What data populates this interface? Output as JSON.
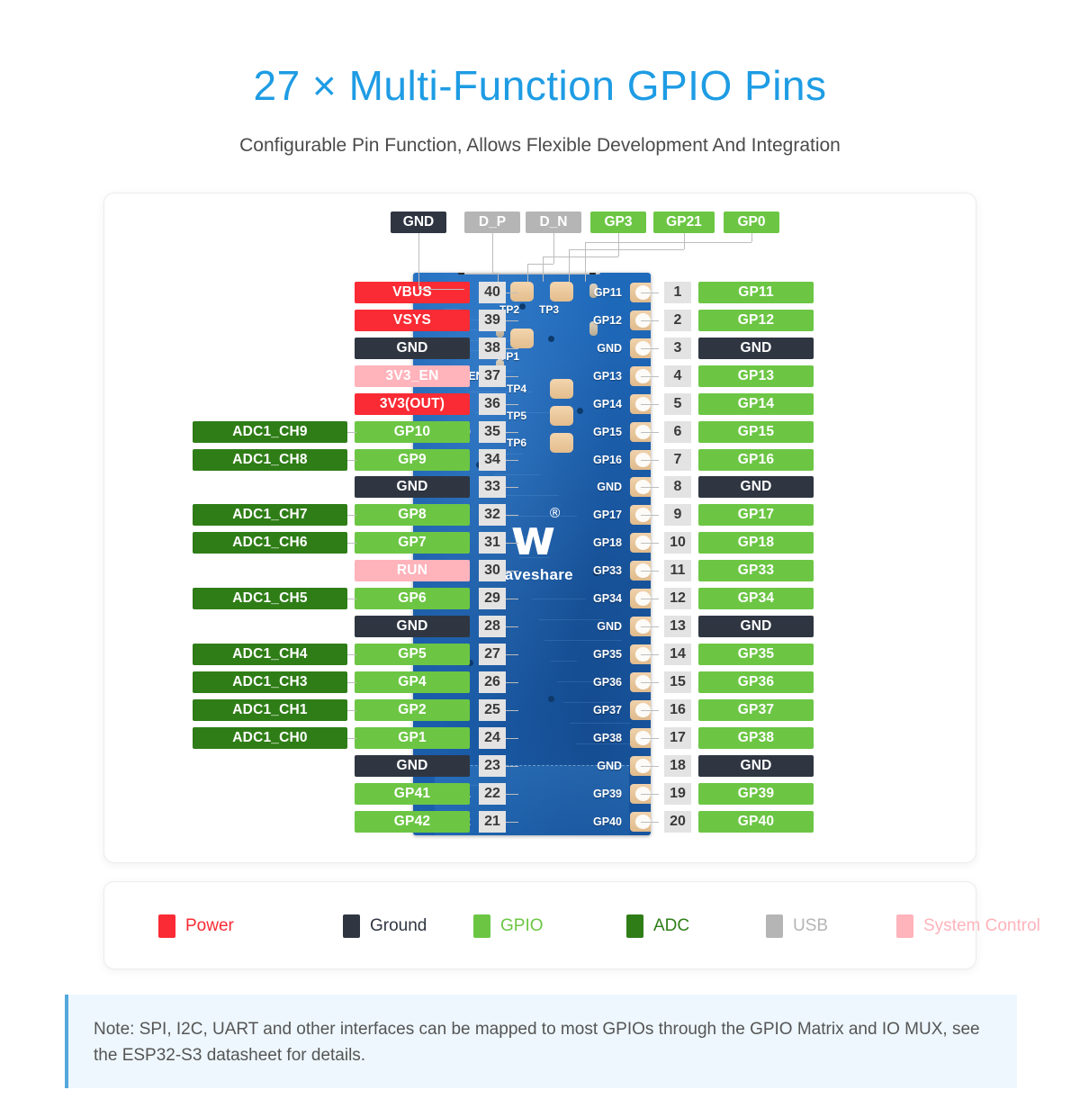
{
  "header": {
    "title": "27 × Multi-Function GPIO Pins",
    "subtitle": "Configurable Pin Function, Allows Flexible Development And Integration"
  },
  "colors": {
    "power": "#fa2b34",
    "ground": "#2f3642",
    "gpio": "#6cc644",
    "adc": "#2f7d17",
    "usb": "#b5b5b5",
    "system_control": "#ffb3bb",
    "accent": "#1e9ce4",
    "board": "#1c60ad"
  },
  "top_labels": [
    {
      "text": "GND",
      "type": "ground"
    },
    {
      "text": "D_P",
      "type": "usb"
    },
    {
      "text": "D_N",
      "type": "usb"
    },
    {
      "text": "GP3",
      "type": "gpio"
    },
    {
      "text": "GP21",
      "type": "gpio"
    },
    {
      "text": "GP0",
      "type": "gpio"
    }
  ],
  "left_pins": [
    {
      "num": "40",
      "name": "VBUS",
      "type": "power",
      "func": "",
      "silk": "Vbus"
    },
    {
      "num": "39",
      "name": "VSYS",
      "type": "power",
      "func": "",
      "silk": "Vsys"
    },
    {
      "num": "38",
      "name": "GND",
      "type": "ground",
      "func": "",
      "silk": "GND"
    },
    {
      "num": "37",
      "name": "3V3_EN",
      "type": "sys",
      "func": "",
      "silk": "3V3_EN"
    },
    {
      "num": "36",
      "name": "3V3(OUT)",
      "type": "power",
      "func": "",
      "silk": "3V3"
    },
    {
      "num": "35",
      "name": "GP10",
      "type": "gpio",
      "func": "ADC1_CH9",
      "silk": "GP10"
    },
    {
      "num": "34",
      "name": "GP9",
      "type": "gpio",
      "func": "ADC1_CH8",
      "silk": "GP9"
    },
    {
      "num": "33",
      "name": "GND",
      "type": "ground",
      "func": "",
      "silk": "GND"
    },
    {
      "num": "32",
      "name": "GP8",
      "type": "gpio",
      "func": "ADC1_CH7",
      "silk": "GP8"
    },
    {
      "num": "31",
      "name": "GP7",
      "type": "gpio",
      "func": "ADC1_CH6",
      "silk": "GP7"
    },
    {
      "num": "30",
      "name": "RUN",
      "type": "sys",
      "func": "",
      "silk": "RUN"
    },
    {
      "num": "29",
      "name": "GP6",
      "type": "gpio",
      "func": "ADC1_CH5",
      "silk": "GP6"
    },
    {
      "num": "28",
      "name": "GND",
      "type": "ground",
      "func": "",
      "silk": "GND"
    },
    {
      "num": "27",
      "name": "GP5",
      "type": "gpio",
      "func": "ADC1_CH4",
      "silk": "GP5"
    },
    {
      "num": "26",
      "name": "GP4",
      "type": "gpio",
      "func": "ADC1_CH3",
      "silk": "GP4"
    },
    {
      "num": "25",
      "name": "GP2",
      "type": "gpio",
      "func": "ADC1_CH1",
      "silk": "GP2"
    },
    {
      "num": "24",
      "name": "GP1",
      "type": "gpio",
      "func": "ADC1_CH0",
      "silk": "GP1"
    },
    {
      "num": "23",
      "name": "GND",
      "type": "ground",
      "func": "",
      "silk": "GND"
    },
    {
      "num": "22",
      "name": "GP41",
      "type": "gpio",
      "func": "",
      "silk": "GP41"
    },
    {
      "num": "21",
      "name": "GP42",
      "type": "gpio",
      "func": "",
      "silk": "GP42"
    }
  ],
  "right_pins": [
    {
      "num": "1",
      "name": "GP11",
      "type": "gpio",
      "silk": "GP11"
    },
    {
      "num": "2",
      "name": "GP12",
      "type": "gpio",
      "silk": "GP12"
    },
    {
      "num": "3",
      "name": "GND",
      "type": "ground",
      "silk": "GND"
    },
    {
      "num": "4",
      "name": "GP13",
      "type": "gpio",
      "silk": "GP13"
    },
    {
      "num": "5",
      "name": "GP14",
      "type": "gpio",
      "silk": "GP14"
    },
    {
      "num": "6",
      "name": "GP15",
      "type": "gpio",
      "silk": "GP15"
    },
    {
      "num": "7",
      "name": "GP16",
      "type": "gpio",
      "silk": "GP16"
    },
    {
      "num": "8",
      "name": "GND",
      "type": "ground",
      "silk": "GND"
    },
    {
      "num": "9",
      "name": "GP17",
      "type": "gpio",
      "silk": "GP17"
    },
    {
      "num": "10",
      "name": "GP18",
      "type": "gpio",
      "silk": "GP18"
    },
    {
      "num": "11",
      "name": "GP33",
      "type": "gpio",
      "silk": "GP33"
    },
    {
      "num": "12",
      "name": "GP34",
      "type": "gpio",
      "silk": "GP34"
    },
    {
      "num": "13",
      "name": "GND",
      "type": "ground",
      "silk": "GND"
    },
    {
      "num": "14",
      "name": "GP35",
      "type": "gpio",
      "silk": "GP35"
    },
    {
      "num": "15",
      "name": "GP36",
      "type": "gpio",
      "silk": "GP36"
    },
    {
      "num": "16",
      "name": "GP37",
      "type": "gpio",
      "silk": "GP37"
    },
    {
      "num": "17",
      "name": "GP38",
      "type": "gpio",
      "silk": "GP38"
    },
    {
      "num": "18",
      "name": "GND",
      "type": "ground",
      "silk": "GND"
    },
    {
      "num": "19",
      "name": "GP39",
      "type": "gpio",
      "silk": "GP39"
    },
    {
      "num": "20",
      "name": "GP40",
      "type": "gpio",
      "silk": "GP40"
    }
  ],
  "test_points": [
    "TP1",
    "TP2",
    "TP3",
    "TP4",
    "TP5",
    "TP6"
  ],
  "board": {
    "brand": "Waveshare",
    "brand_mark": "w",
    "registered": "®"
  },
  "legend": [
    {
      "label": "Power",
      "swatch": "#fa2b34",
      "text_color": "#fa2b34"
    },
    {
      "label": "Ground",
      "swatch": "#2f3642",
      "text_color": "#2f3642"
    },
    {
      "label": "GPIO",
      "swatch": "#6cc644",
      "text_color": "#6cc644"
    },
    {
      "label": "ADC",
      "swatch": "#2f7d17",
      "text_color": "#2f7d17"
    },
    {
      "label": "USB",
      "swatch": "#b5b5b5",
      "text_color": "#b5b5b5"
    },
    {
      "label": "System Control",
      "swatch": "#ffb3bb",
      "text_color": "#ffb3bb"
    }
  ],
  "note": {
    "text": "Note: SPI, I2C, UART and other interfaces can be mapped to most GPIOs through the GPIO Matrix and IO MUX, see the ESP32-S3 datasheet for details."
  }
}
